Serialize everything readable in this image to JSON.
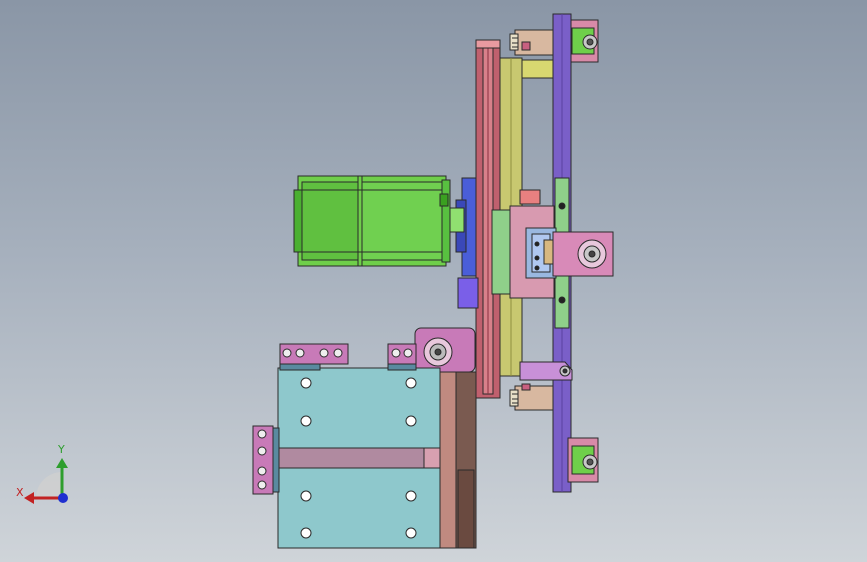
{
  "view": {
    "background_top": "#8a96a6",
    "background_bottom": "#cfd4d9"
  },
  "triad": {
    "x_label": "X",
    "y_label": "Y",
    "x_color": "#c22222",
    "y_color": "#2e9e2e",
    "z_color": "#1f2fd0"
  },
  "model": {
    "parts": [
      {
        "name": "stepper-motor",
        "color": "#6fcf4a"
      },
      {
        "name": "timing-belt-plate",
        "color": "#c0606e"
      },
      {
        "name": "linear-guide",
        "color": "#c8c870"
      },
      {
        "name": "vertical-rail",
        "color": "#7a5fc8"
      },
      {
        "name": "base-block",
        "color": "#8ec8cc"
      },
      {
        "name": "clamp-bracket",
        "color": "#c87ab8"
      },
      {
        "name": "slider-carriage",
        "color": "#d89ab0"
      }
    ]
  }
}
